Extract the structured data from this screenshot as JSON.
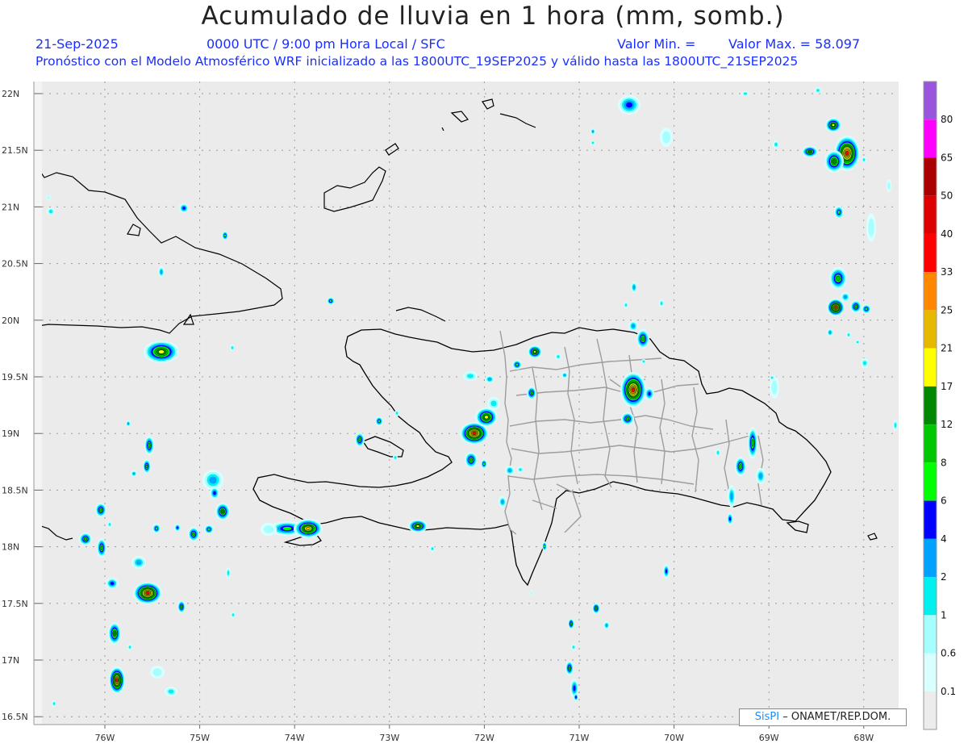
{
  "title": "Acumulado de lluvia en 1 hora (mm, somb.)",
  "date": "21-Sep-2025",
  "time": "0000 UTC / 9:00 pm Hora Local / SFC",
  "valmin": "Valor Min. =",
  "valmax": "Valor Max. = 58.097",
  "forecast_line": "Pronóstico con el Modelo Atmosférico WRF inicializado a las 1800UTC_19SEP2025 y válido hasta las 1800UTC_21SEP2025",
  "credit": {
    "brand": "SisPI",
    "text": "– ONAMET/REP.DOM."
  },
  "lat_labels": [
    "22N",
    "21.5N",
    "21N",
    "20.5N",
    "20N",
    "19.5N",
    "19N",
    "18.5N",
    "18N",
    "17.5N",
    "17N",
    "16.5N"
  ],
  "lon_labels": [
    "76W",
    "75W",
    "74W",
    "73W",
    "72W",
    "71W",
    "70W",
    "69W",
    "68W"
  ],
  "colorbar": {
    "labels": [
      "0.1",
      "0.6",
      "1",
      "2",
      "4",
      "6",
      "8",
      "12",
      "17",
      "21",
      "25",
      "33",
      "40",
      "50",
      "65",
      "80"
    ],
    "colors": [
      "#ececec",
      "#d9ffff",
      "#a6ffff",
      "#00f0f0",
      "#00a2ff",
      "#0000ff",
      "#00ff00",
      "#00c800",
      "#008800",
      "#ffff00",
      "#e6b800",
      "#ff8800",
      "#ff0000",
      "#dd0000",
      "#aa0000",
      "#ff00ff",
      "#9955dd"
    ]
  },
  "field_colors": {
    "ocean": "#ebebeb",
    "coast": "#000000",
    "province": "#999999",
    "grid": "#aaaaaa"
  }
}
